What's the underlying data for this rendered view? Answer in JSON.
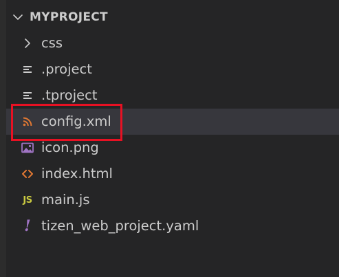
{
  "explorer": {
    "section_title": "MYPROJECT",
    "chevron_icon": "chevron-down-icon",
    "items": [
      {
        "label": "css",
        "icon": "chevron-right-icon",
        "kind": "folder"
      },
      {
        "label": ".project",
        "icon": "text-lines-icon",
        "kind": "file"
      },
      {
        "label": ".tproject",
        "icon": "text-lines-icon",
        "kind": "file"
      },
      {
        "label": "config.xml",
        "icon": "rss-feed-icon",
        "kind": "file",
        "selected": true,
        "highlighted": true
      },
      {
        "label": "icon.png",
        "icon": "image-icon",
        "kind": "file"
      },
      {
        "label": "index.html",
        "icon": "code-brackets-icon",
        "kind": "file"
      },
      {
        "label": "main.js",
        "icon": "js-icon",
        "kind": "file",
        "icon_text": "JS"
      },
      {
        "label": "tizen_web_project.yaml",
        "icon": "exclamation-icon",
        "kind": "file",
        "icon_text": "!"
      }
    ]
  },
  "colors": {
    "background": "#252526",
    "left_strip": "#2c2c2c",
    "text": "#cccccc",
    "selected_row": "#37373d",
    "highlight_border": "#e81123",
    "xml_icon": "#e37933",
    "image_icon": "#a074c4",
    "html_icon": "#e37933",
    "js_icon": "#cbcb41",
    "yaml_icon": "#a074c4",
    "lines_icon": "#cccccc"
  }
}
